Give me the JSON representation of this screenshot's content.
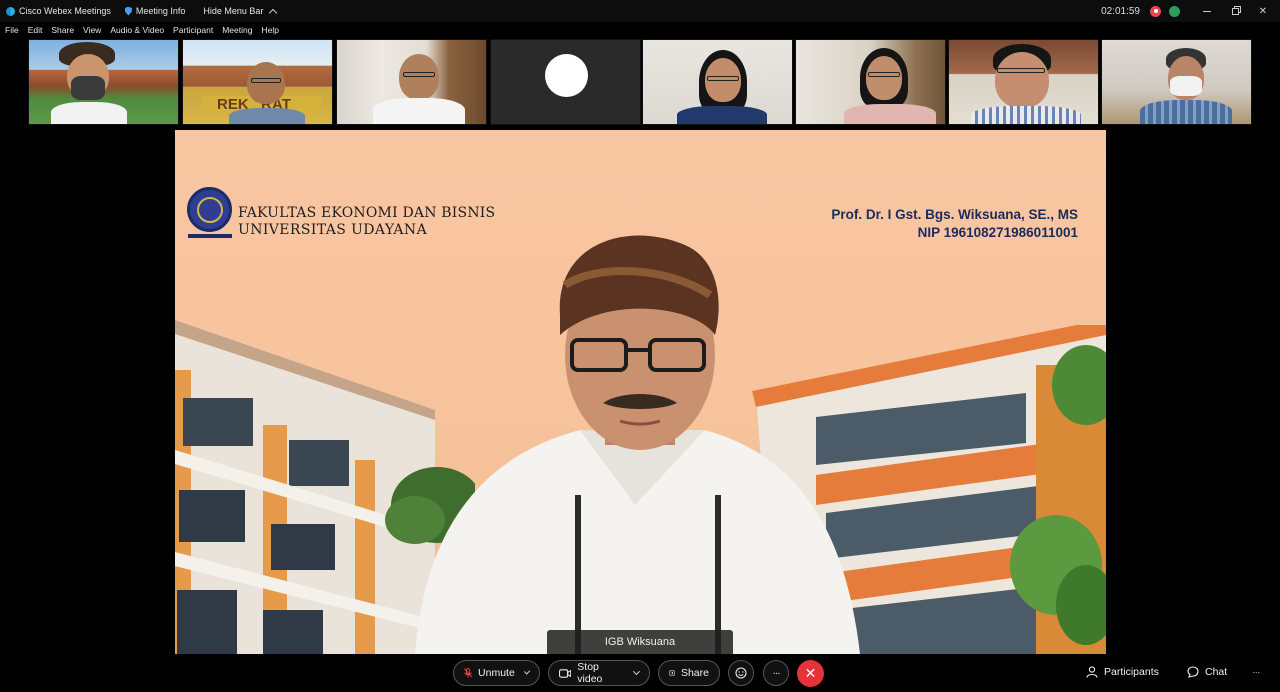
{
  "titlebar": {
    "app_name": "Cisco Webex Meetings",
    "meeting_info": "Meeting Info",
    "hide_menu": "Hide Menu Bar",
    "clock": "02:01:59",
    "minimize_glyph": "–",
    "close_glyph": "✕"
  },
  "menu": {
    "items": [
      "File",
      "Edit",
      "Share",
      "View",
      "Audio & Video",
      "Participant",
      "Meeting",
      "Help"
    ]
  },
  "participants_strip": {
    "tile_count": 8
  },
  "main": {
    "institution_line1": "FAKULTAS EKONOMI DAN BISNIS",
    "institution_line2": "UNIVERSITAS UDAYANA",
    "presenter_title": "Prof. Dr. I Gst. Bgs. Wiksuana, SE., MS",
    "presenter_nip": "NIP 196108271986011001",
    "speaker_name": "IGB Wiksuana"
  },
  "controls": {
    "unmute_label": "Unmute",
    "stop_video_label": "Stop video",
    "share_label": "Share",
    "more_glyph": "···",
    "end_glyph": "✕",
    "participants_label": "Participants",
    "chat_label": "Chat",
    "overflow_glyph": "···"
  },
  "colors": {
    "accent_end": "#e5333a",
    "background_main": "#f8c9a6",
    "title_text": "#1d2b5c"
  },
  "icons": [
    "webex-icon",
    "shield-icon",
    "mic-muted-icon",
    "camera-icon",
    "share-icon",
    "reactions-icon",
    "more-icon",
    "end-call-icon",
    "participants-icon",
    "chat-icon"
  ]
}
